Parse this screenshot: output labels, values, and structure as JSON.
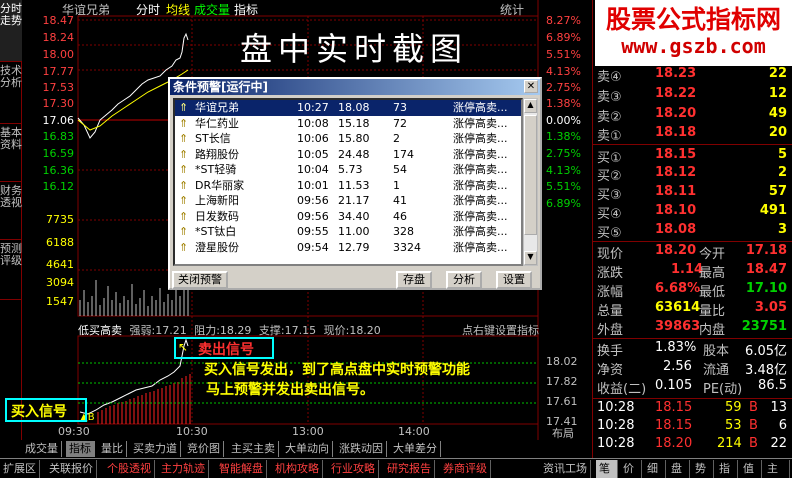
{
  "left_tabs": [
    "分时走势",
    "技术分析",
    "基本资料",
    "财务透视",
    "预测评级"
  ],
  "chart_header": {
    "stock": "华谊兄弟",
    "mode": "分时",
    "avg": "均线",
    "volume": "成交量",
    "indicator": "指标",
    "stats": "统计"
  },
  "price_axis_left": [
    "18.47",
    "18.24",
    "18.00",
    "17.77",
    "17.53",
    "17.30",
    "17.06",
    "16.83",
    "16.59",
    "16.36",
    "16.12",
    "7735",
    "6188",
    "4641",
    "3094",
    "1547"
  ],
  "price_axis_right": [
    "8.27%",
    "6.89%",
    "5.51%",
    "4.13%",
    "2.75%",
    "1.38%",
    "0.00%",
    "1.38%",
    "2.75%",
    "4.13%",
    "5.51%",
    "6.89%"
  ],
  "title_overlay": "盘中实时截图",
  "brand": {
    "name": "股票公式指标网",
    "url": "www.gszb.com"
  },
  "dialog": {
    "title": "条件预警[运行中]",
    "rows": [
      {
        "name": "华谊兄弟",
        "time": "10:27",
        "price": "18.08",
        "vol": "73",
        "cond": "涨停高卖..."
      },
      {
        "name": "华仁药业",
        "time": "10:08",
        "price": "15.18",
        "vol": "72",
        "cond": "涨停高卖..."
      },
      {
        "name": "ST长信",
        "time": "10:06",
        "price": "15.80",
        "vol": "2",
        "cond": "涨停高卖..."
      },
      {
        "name": "路翔股份",
        "time": "10:05",
        "price": "24.48",
        "vol": "174",
        "cond": "涨停高卖..."
      },
      {
        "name": "*ST轻骑",
        "time": "10:04",
        "price": "5.73",
        "vol": "54",
        "cond": "涨停高卖..."
      },
      {
        "name": "DR华丽家",
        "time": "10:01",
        "price": "11.53",
        "vol": "1",
        "cond": "涨停高卖..."
      },
      {
        "name": "上海新阳",
        "time": "09:56",
        "price": "21.17",
        "vol": "41",
        "cond": "涨停高卖..."
      },
      {
        "name": "日发数码",
        "time": "09:56",
        "price": "34.40",
        "vol": "46",
        "cond": "涨停高卖..."
      },
      {
        "name": "*ST钛白",
        "time": "09:55",
        "price": "11.00",
        "vol": "328",
        "cond": "涨停高卖..."
      },
      {
        "name": "澄星股份",
        "time": "09:54",
        "price": "12.79",
        "vol": "3324",
        "cond": "涨停高卖..."
      }
    ],
    "btn_close": "关闭预警",
    "btn_save": "存盘",
    "btn_analyze": "分析",
    "btn_settings": "设置"
  },
  "indicator_bar": {
    "name": "低买高卖",
    "strength": "强弱:17.21",
    "resistance": "阻力:18.29",
    "support": "支撑:17.15",
    "price": "现价:18.20",
    "hint": "点右键设置指标"
  },
  "ind_axis": [
    "18.02",
    "17.82",
    "17.61",
    "17.41"
  ],
  "sell_signal": "卖出信号",
  "buy_signal": "买入信号",
  "annotation": [
    "买入信号发出，到了高点盘中实时预警功能",
    "马上预警并发出卖出信号。"
  ],
  "time_axis": [
    "09:30",
    "10:30",
    "13:00",
    "14:00",
    "布局"
  ],
  "bottom_tabs": [
    "成交量",
    "指标",
    "量比",
    "买卖力道",
    "竞价图",
    "主买主卖",
    "大单动向",
    "涨跌动因",
    "大单差分"
  ],
  "bottom_bar": [
    "扩展区",
    "关联报价",
    "个股透视",
    "主力轨迹",
    "智能解盘",
    "机构攻略",
    "行业攻略",
    "研究报告",
    "券商评级",
    "资讯工场"
  ],
  "side_bottom_tabs": [
    "笔",
    "价",
    "细",
    "盘",
    "势",
    "指",
    "值",
    "主"
  ],
  "order_book": {
    "asks": [
      {
        "n": "卖⑤",
        "p": "",
        "v": ""
      },
      {
        "n": "卖④",
        "p": "18.23",
        "v": "22"
      },
      {
        "n": "卖③",
        "p": "18.22",
        "v": "12"
      },
      {
        "n": "卖②",
        "p": "18.20",
        "v": "49"
      },
      {
        "n": "卖①",
        "p": "18.18",
        "v": "20"
      }
    ],
    "bids": [
      {
        "n": "买①",
        "p": "18.15",
        "v": "5"
      },
      {
        "n": "买②",
        "p": "18.12",
        "v": "2"
      },
      {
        "n": "买③",
        "p": "18.11",
        "v": "57"
      },
      {
        "n": "买④",
        "p": "18.10",
        "v": "491"
      },
      {
        "n": "买⑤",
        "p": "18.08",
        "v": "3"
      }
    ]
  },
  "quote": [
    [
      "现价",
      "18.20",
      "今开",
      "17.18"
    ],
    [
      "涨跌",
      "1.14",
      "最高",
      "18.47"
    ],
    [
      "涨幅",
      "6.68%",
      "最低",
      "17.10"
    ],
    [
      "总量",
      "63614",
      "量比",
      "3.05"
    ],
    [
      "外盘",
      "39863",
      "内盘",
      "23751"
    ],
    [
      "换手",
      "1.83%",
      "股本",
      "6.05亿"
    ],
    [
      "净资",
      "2.56",
      "流通",
      "3.48亿"
    ],
    [
      "收益(二)",
      "0.105",
      "PE(动)",
      "86.5"
    ]
  ],
  "ticks": [
    {
      "t": "10:28",
      "p": "18.15",
      "v": "59",
      "d": "B",
      "c": "13"
    },
    {
      "t": "10:28",
      "p": "18.15",
      "v": "53",
      "d": "B",
      "c": "6"
    },
    {
      "t": "10:28",
      "p": "18.20",
      "v": "214",
      "d": "B",
      "c": "22"
    }
  ],
  "colors": {
    "up": "#ff3030",
    "down": "#00c000",
    "yellow": "#ffff00",
    "cyan": "#00ffff",
    "grid": "#800000"
  }
}
